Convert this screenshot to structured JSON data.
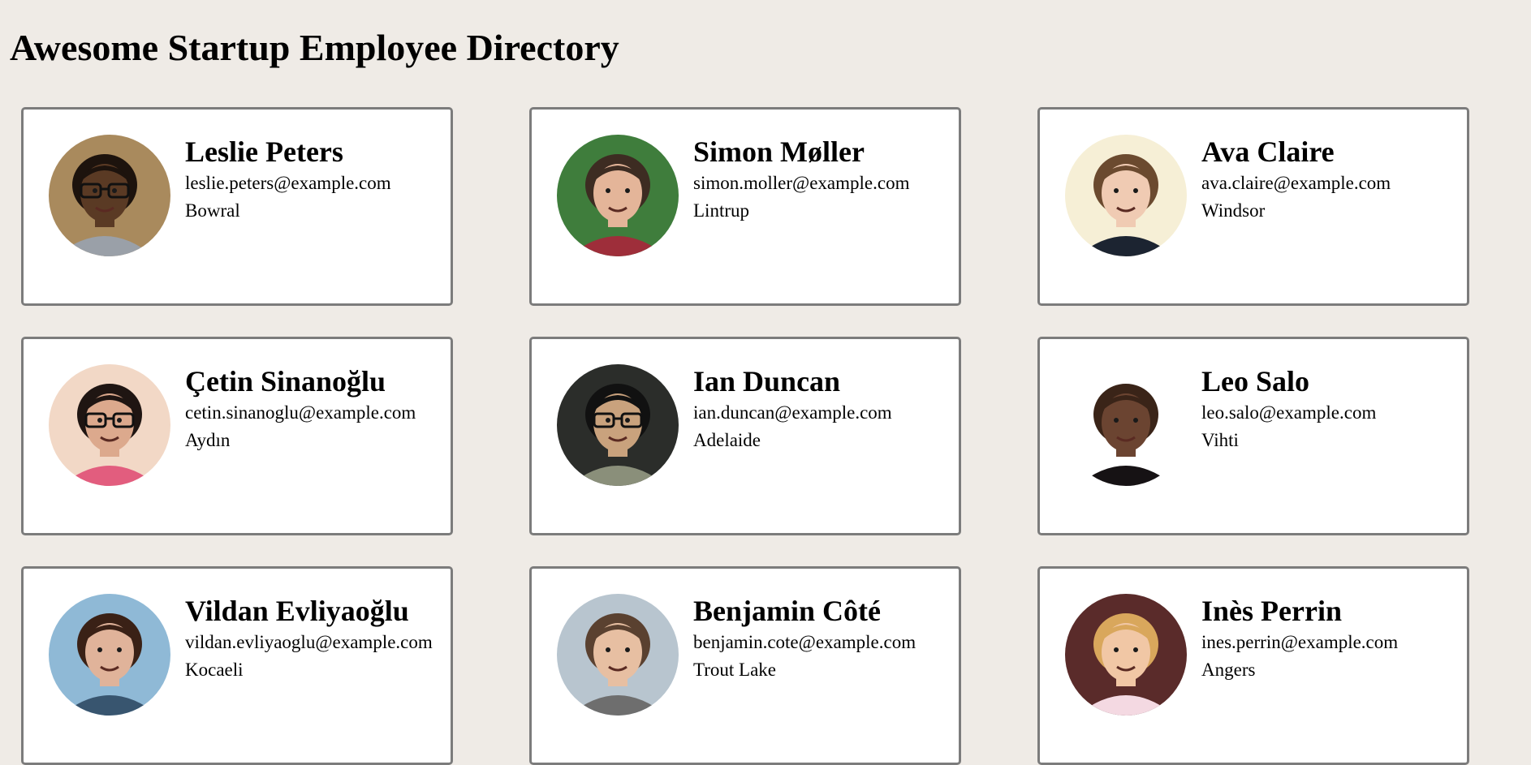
{
  "header": {
    "title": "Awesome Startup Employee Directory"
  },
  "employees": [
    {
      "name": "Leslie Peters",
      "email": "leslie.peters@example.com",
      "city": "Bowral",
      "photo": {
        "bg": "#a98a5d",
        "skin": "#5a3a24",
        "hair": "#1d130d",
        "shirt": "#9aa0a8",
        "glasses": true,
        "offset": -6
      }
    },
    {
      "name": "Simon Møller",
      "email": "simon.moller@example.com",
      "city": "Lintrup",
      "photo": {
        "bg": "#3f7d3c",
        "skin": "#e4b599",
        "hair": "#3d2c22",
        "shirt": "#9e2e3a",
        "glasses": false,
        "offset": 0
      }
    },
    {
      "name": "Ava Claire",
      "email": "ava.claire@example.com",
      "city": "Windsor",
      "photo": {
        "bg": "#f6efd6",
        "skin": "#f0cbb3",
        "hair": "#6b4a2f",
        "shirt": "#1c2431",
        "glasses": false,
        "offset": 0
      }
    },
    {
      "name": "Çetin Sinanoğlu",
      "email": "cetin.sinanoglu@example.com",
      "city": "Aydın",
      "photo": {
        "bg": "#f2d8c6",
        "skin": "#dca98d",
        "hair": "#1f1512",
        "shirt": "#e25d7e",
        "glasses": true,
        "offset": 0
      }
    },
    {
      "name": "Ian Duncan",
      "email": "ian.duncan@example.com",
      "city": "Adelaide",
      "photo": {
        "bg": "#2b2d2a",
        "skin": "#c9a27d",
        "hair": "#111111",
        "shirt": "#8a8f7a",
        "glasses": true,
        "offset": 0
      }
    },
    {
      "name": "Leo Salo",
      "email": "leo.salo@example.com",
      "city": "Vihti",
      "photo": {
        "bg": "#ffffff",
        "skin": "#6b4431",
        "hair": "#3a2418",
        "shirt": "#161214",
        "glasses": false,
        "offset": 0
      }
    },
    {
      "name": "Vildan Evliyaoğlu",
      "email": "vildan.evliyaoglu@example.com",
      "city": "Kocaeli",
      "photo": {
        "bg": "#8fb9d6",
        "skin": "#e0b39a",
        "hair": "#3a2116",
        "shirt": "#38556f",
        "glasses": false,
        "offset": 0
      }
    },
    {
      "name": "Benjamin Côté",
      "email": "benjamin.cote@example.com",
      "city": "Trout Lake",
      "photo": {
        "bg": "#b8c5cf",
        "skin": "#e7bfa2",
        "hair": "#5a4130",
        "shirt": "#6e6e6e",
        "glasses": false,
        "offset": 0
      }
    },
    {
      "name": "Inès Perrin",
      "email": "ines.perrin@example.com",
      "city": "Angers",
      "photo": {
        "bg": "#5a2b2a",
        "skin": "#f1c7a5",
        "hair": "#d9a75c",
        "shirt": "#f4d9e2",
        "glasses": false,
        "offset": 0
      }
    }
  ]
}
